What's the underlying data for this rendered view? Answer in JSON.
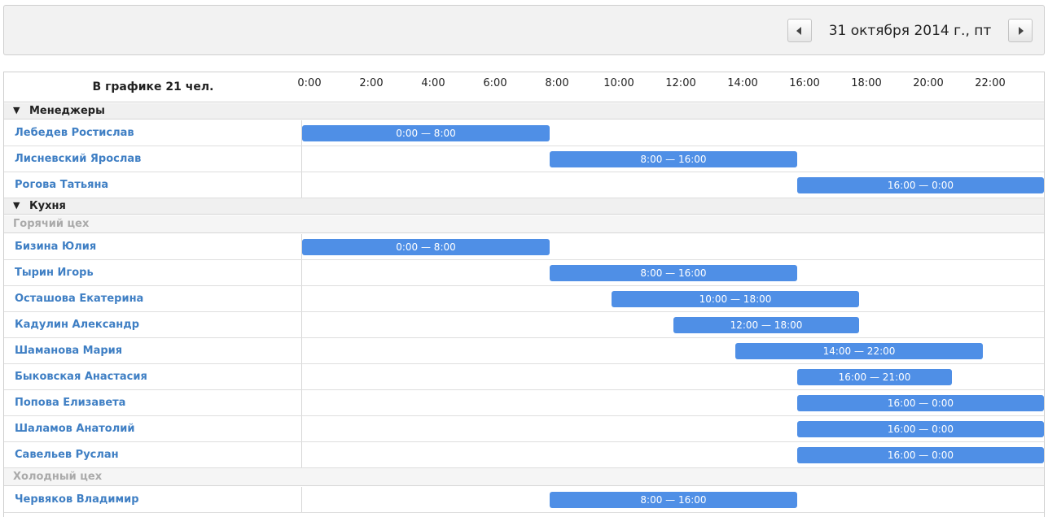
{
  "toolbar": {
    "date": "31 октября 2014 г., пт",
    "prev_icon": "chevron-left-icon",
    "next_icon": "chevron-right-icon"
  },
  "grid": {
    "summary": "В графике 21 чел.",
    "hours": [
      "0:00",
      "2:00",
      "4:00",
      "6:00",
      "8:00",
      "10:00",
      "12:00",
      "14:00",
      "16:00",
      "18:00",
      "20:00",
      "22:00"
    ]
  },
  "rows": [
    {
      "type": "group",
      "name": "Менеджеры"
    },
    {
      "type": "employee",
      "name": "Лебедев Ростислав",
      "start": 0,
      "end": 8,
      "label": "0:00 — 8:00"
    },
    {
      "type": "employee",
      "name": "Лисневский Ярослав",
      "start": 8,
      "end": 16,
      "label": "8:00 — 16:00"
    },
    {
      "type": "employee",
      "name": "Рогова Татьяна",
      "start": 16,
      "end": 24,
      "label": "16:00 — 0:00"
    },
    {
      "type": "group",
      "name": "Кухня"
    },
    {
      "type": "subgroup",
      "name": "Горячий цех"
    },
    {
      "type": "employee",
      "name": "Бизина Юлия",
      "start": 0,
      "end": 8,
      "label": "0:00 — 8:00"
    },
    {
      "type": "employee",
      "name": "Тырин Игорь",
      "start": 8,
      "end": 16,
      "label": "8:00 — 16:00"
    },
    {
      "type": "employee",
      "name": "Осташова Екатерина",
      "start": 10,
      "end": 18,
      "label": "10:00 — 18:00"
    },
    {
      "type": "employee",
      "name": "Кадулин Александр",
      "start": 12,
      "end": 18,
      "label": "12:00 — 18:00"
    },
    {
      "type": "employee",
      "name": "Шаманова Мария",
      "start": 14,
      "end": 22,
      "label": "14:00 — 22:00"
    },
    {
      "type": "employee",
      "name": "Быковская Анастасия",
      "start": 16,
      "end": 21,
      "label": "16:00 — 21:00"
    },
    {
      "type": "employee",
      "name": "Попова Елизавета",
      "start": 16,
      "end": 24,
      "label": "16:00 — 0:00"
    },
    {
      "type": "employee",
      "name": "Шаламов Анатолий",
      "start": 16,
      "end": 24,
      "label": "16:00 — 0:00"
    },
    {
      "type": "employee",
      "name": "Савельев Руслан",
      "start": 16,
      "end": 24,
      "label": "16:00 — 0:00"
    },
    {
      "type": "subgroup",
      "name": "Холодный цех"
    },
    {
      "type": "employee",
      "name": "Червяков Владимир",
      "start": 8,
      "end": 16,
      "label": "8:00 — 16:00"
    }
  ]
}
